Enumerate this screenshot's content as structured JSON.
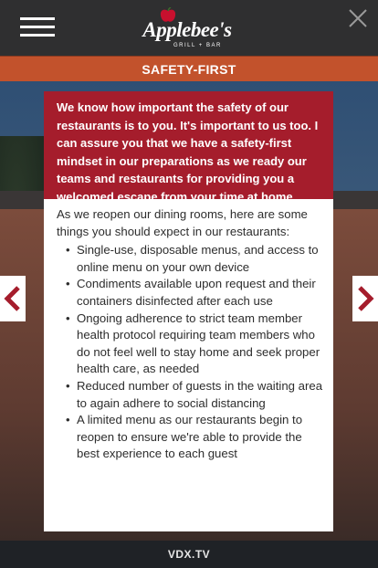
{
  "header": {
    "logo_text": "Applebee's",
    "logo_subtext": "GRILL + BAR"
  },
  "banner": {
    "title": "SAFETY-FIRST"
  },
  "panel": {
    "headline": "We know how important the safety of our restaurants is to you. It's important to us too. I can assure you that we have a safety-first mindset in our preparations as we ready our teams and restaurants for providing you a welcomed escape from your time at home.",
    "intro": "As we reopen our dining rooms, here are some things you should expect in our restaurants:",
    "items": [
      "Single-use, disposable menus, and access to online menu on your own device",
      "Condiments available upon request and their containers disinfected after each use",
      "Ongoing adherence to strict team member health protocol requiring team members who do not feel well to stay home and seek proper health care, as needed",
      "Reduced number of guests in the waiting area to again adhere to social distancing",
      "A limited menu as our restaurants begin to reopen to ensure we're able to provide the best experience to each guest"
    ]
  },
  "footer": {
    "label": "VDX.TV"
  },
  "colors": {
    "header_bg": "#2f2f30",
    "banner_bg": "#c2522c",
    "headline_bg": "#a51d2c",
    "arrow": "#a51d2c"
  },
  "icons": {
    "menu": "hamburger-icon",
    "close": "close-icon",
    "prev": "chevron-left-icon",
    "next": "chevron-right-icon"
  }
}
